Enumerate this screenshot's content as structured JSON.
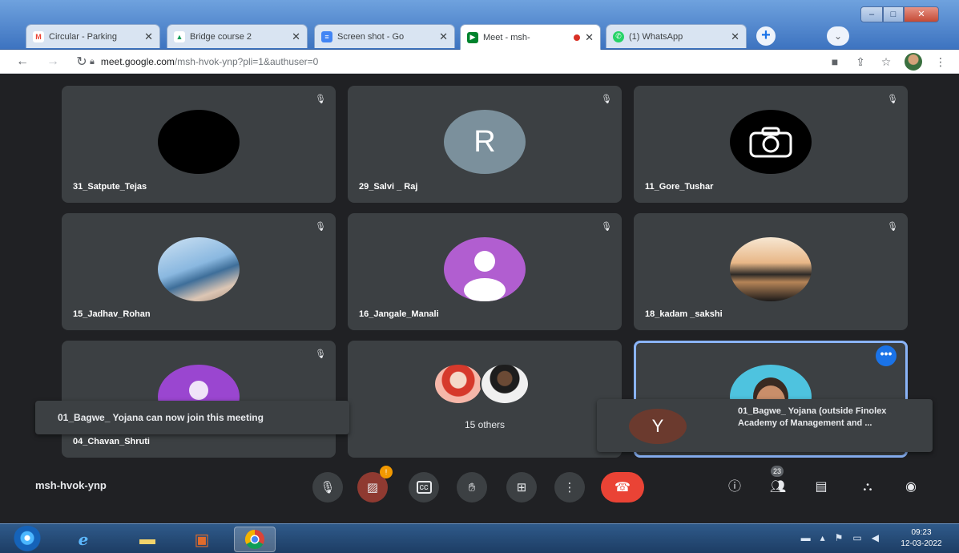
{
  "browser": {
    "tabs": [
      {
        "title": "Circular - Parking",
        "icon": "gmail-icon",
        "fav_color": "#ea4335",
        "fav_char": "M",
        "active": false
      },
      {
        "title": "Bridge course 2",
        "icon": "drive-icon",
        "fav_color": "#0f9d58",
        "fav_char": "▲",
        "active": false
      },
      {
        "title": "Screen shot - Go",
        "icon": "docs-icon",
        "fav_color": "#4285f4",
        "fav_char": "≡",
        "active": false
      },
      {
        "title": "Meet - msh-",
        "icon": "meet-icon",
        "fav_color": "#00832d",
        "fav_char": "▶",
        "active": true
      },
      {
        "title": "(1) WhatsApp",
        "icon": "whatsapp-icon",
        "fav_color": "#25d366",
        "fav_char": "✆",
        "active": false
      }
    ],
    "url_host": "meet.google.com",
    "url_path": "/msh-hvok-ynp?pli=1&authuser=0"
  },
  "participants": [
    {
      "name": "31_Satpute_Tejas",
      "avatar": "black",
      "letter": ""
    },
    {
      "name": "29_Salvi _ Raj",
      "avatar": "letter",
      "letter": "R"
    },
    {
      "name": "11_Gore_Tushar",
      "avatar": "camera",
      "letter": ""
    },
    {
      "name": "15_Jadhav_Rohan",
      "avatar": "photo-sea",
      "letter": ""
    },
    {
      "name": "16_Jangale_Manali",
      "avatar": "person",
      "letter": ""
    },
    {
      "name": "18_kadam _sakshi",
      "avatar": "sunset",
      "letter": ""
    },
    {
      "name": "04_Chavan_Shruti",
      "avatar": "purple",
      "letter": ""
    }
  ],
  "others_label": "15 others",
  "self_tile": {
    "more_label": "•••"
  },
  "toast_join": "01_Bagwe_ Yojana can now join this meeting",
  "toast_request": {
    "avatar_letter": "Y",
    "text": "01_Bagwe_ Yojana (outside Finolex Academy of Management and ..."
  },
  "meeting_code": "msh-hvok-ynp",
  "controls": {
    "camera_badge": "!",
    "people_count": "23"
  },
  "taskbar": {
    "time": "09:23",
    "date": "12-03-2022"
  },
  "colors": {
    "meet_bg": "#202124",
    "tile_bg": "#3c4043",
    "hangup": "#ea4335",
    "accent": "#1a73e8"
  }
}
